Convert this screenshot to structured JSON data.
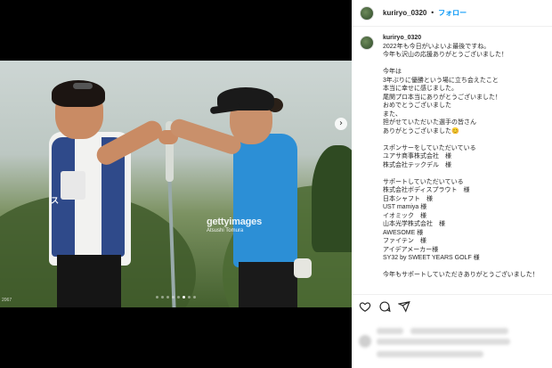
{
  "header": {
    "username": "kuriryo_0320",
    "separator": "•",
    "follow_label": "フォロー"
  },
  "photo": {
    "watermark_logo": "gettyimages",
    "watermark_credit": "Atsushi Tomura",
    "photo_id": "2067",
    "caddie_bib_text": "ス",
    "carousel": {
      "count": 8,
      "active_index": 5
    },
    "next_icon": "chevron-right-icon"
  },
  "caption": {
    "username": "kuriryo_0320",
    "lines": [
      "2022年も今日がいよいよ最後ですね。",
      "今年も沢山の応援ありがとうございました！",
      "",
      "今年は",
      "3年ぶりに優勝という場に立ち会えたこと",
      "本当に幸せに感じました。",
      "尾関プロ本当にありがとうございました！",
      "おめでとうございました",
      "また、",
      "担がせていただいた選手の皆さん",
      "ありがとうございました😊",
      "",
      "スポンサーをしていただいている",
      "ユアサ商事株式会社　様",
      "株式会社テックデル　様",
      "",
      "サポートしていただいている",
      "株式会社ボディスプラウト　様",
      "日本シャフト　様",
      "UST mamiya 様",
      "イオミック　様",
      "山本光学株式会社　様",
      "AWESOME 様",
      "ファイテン　様",
      "アイデアメーカー様",
      "SY32 by SWEET YEARS GOLF 様",
      "",
      "今年もサポートしていただきありがとうございました！"
    ]
  },
  "actions": {
    "icons": [
      "heart-icon",
      "comment-icon",
      "share-icon"
    ]
  }
}
